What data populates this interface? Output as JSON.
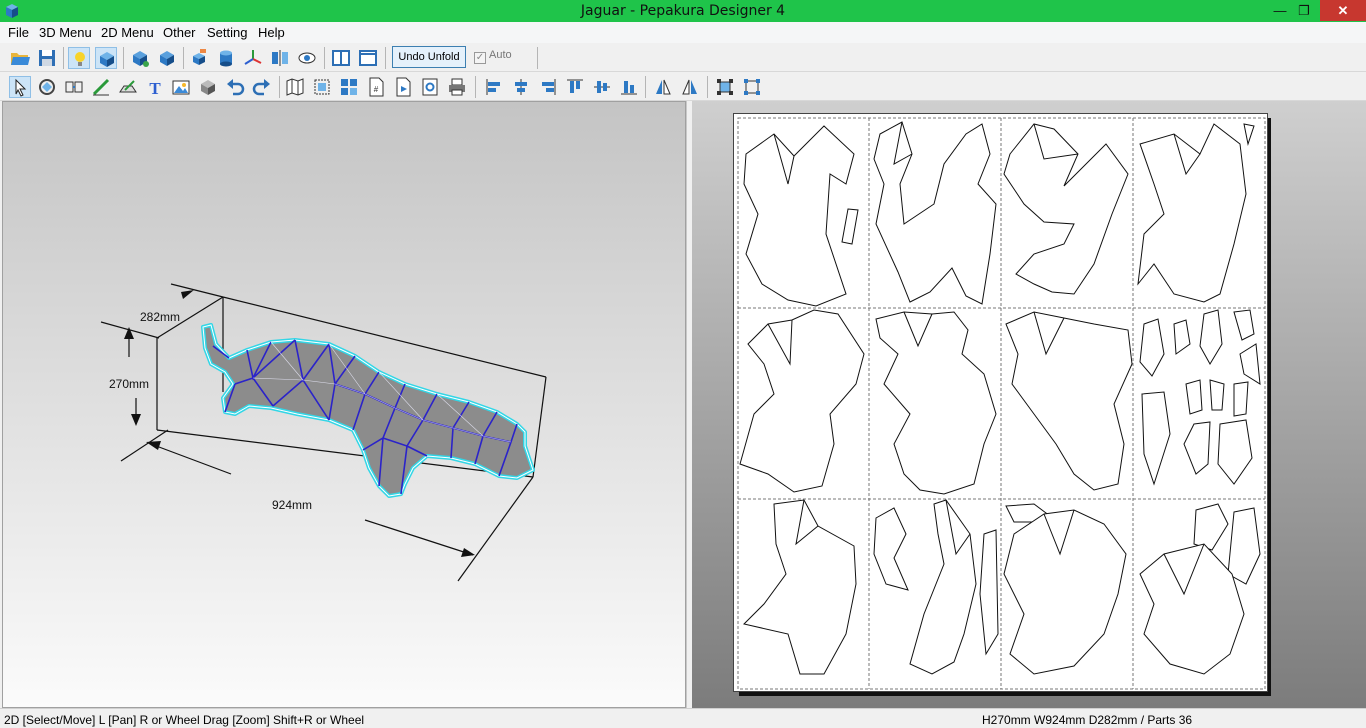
{
  "window": {
    "title": "Jaguar - Pepakura Designer 4",
    "controls": {
      "minimize": "—",
      "maximize": "❐",
      "close": "✕"
    }
  },
  "menu": [
    "File",
    "3D Menu",
    "2D Menu",
    "Other",
    "Setting",
    "Help"
  ],
  "toolbar1": {
    "undo_unfold": "Undo Unfold",
    "auto_label": "Auto",
    "auto_checked": true
  },
  "viewer3d": {
    "dims": {
      "depth": "282mm",
      "height": "270mm",
      "width": "924mm"
    }
  },
  "status": {
    "left": "2D [Select/Move] L [Pan] R or Wheel Drag [Zoom] Shift+R or Wheel",
    "right": "H270mm W924mm D282mm / Parts 36"
  },
  "colors": {
    "title_bar": "#1fc44a",
    "close": "#c7372f",
    "mesh_outline": "#32d6e6",
    "mesh_edges": "#2b23c9",
    "mesh_fill": "#8c8c8c"
  }
}
